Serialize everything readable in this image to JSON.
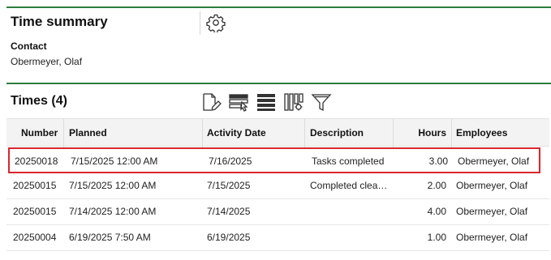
{
  "summary": {
    "title": "Time summary",
    "contact_label": "Contact",
    "contact_value": "Obermeyer, Olaf"
  },
  "times": {
    "title": "Times (4)",
    "toolbar_icons": [
      "edit-document-icon",
      "select-rows-icon",
      "list-view-icon",
      "column-settings-icon",
      "filter-icon"
    ],
    "columns": [
      "Number",
      "Planned",
      "Activity Date",
      "Description",
      "Hours",
      "Employees"
    ],
    "rows": [
      {
        "number": "20250018",
        "planned": "7/15/2025 12:00 AM",
        "activity_date": "7/16/2025",
        "description": "Tasks completed",
        "hours": "3.00",
        "employees": "Obermeyer, Olaf"
      },
      {
        "number": "20250015",
        "planned": "7/15/2025 12:00 AM",
        "activity_date": "7/15/2025",
        "description": "Completed clean...",
        "hours": "2.00",
        "employees": "Obermeyer, Olaf"
      },
      {
        "number": "20250015",
        "planned": "7/14/2025 12:00 AM",
        "activity_date": "7/14/2025",
        "description": "",
        "hours": "4.00",
        "employees": "Obermeyer, Olaf"
      },
      {
        "number": "20250004",
        "planned": "6/19/2025 7:50 AM",
        "activity_date": "6/19/2025",
        "description": "",
        "hours": "1.00",
        "employees": "Obermeyer, Olaf"
      }
    ],
    "selected_row_index": 0
  },
  "colors": {
    "section_rule": "#2e7d3e",
    "selection_border": "#d9262e",
    "header_bg": "#f3f3f3"
  }
}
